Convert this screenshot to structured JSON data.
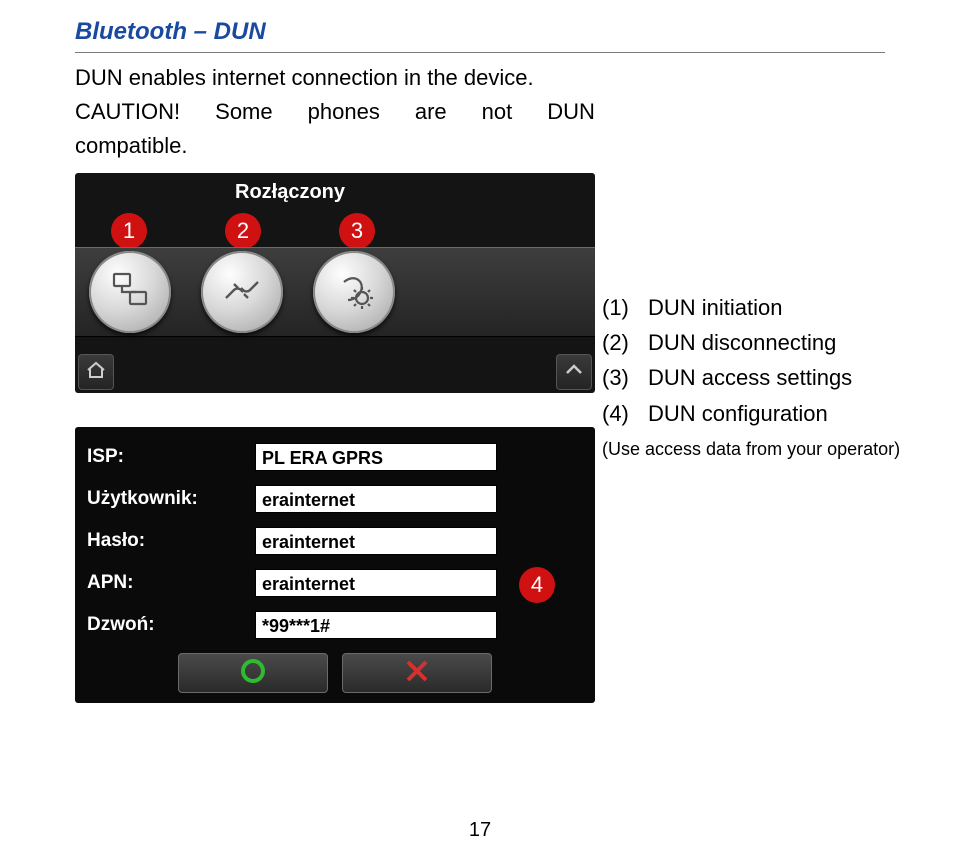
{
  "heading": "Bluetooth – DUN",
  "intro": "DUN enables internet connection in the device.",
  "caution_label": "CAUTION!",
  "caution_words": [
    "Some",
    "phones",
    "are",
    "not",
    "DUN"
  ],
  "caution_tail": "compatible.",
  "screenshot1": {
    "status": "Rozłączony",
    "badges": [
      "1",
      "2",
      "3"
    ],
    "buttons": [
      {
        "name": "dun-initiation-button",
        "icon": "network-icon"
      },
      {
        "name": "dun-disconnect-button",
        "icon": "unplug-icon"
      },
      {
        "name": "dun-settings-button",
        "icon": "browser-gear-icon"
      }
    ],
    "corner_left_icon": "home-icon",
    "corner_right_icon": "chevron-up-icon"
  },
  "legend": {
    "items": [
      {
        "num": "(1)",
        "text": "DUN initiation"
      },
      {
        "num": "(2)",
        "text": "DUN disconnecting"
      },
      {
        "num": "(3)",
        "text": "DUN access settings"
      },
      {
        "num": "(4)",
        "text": "DUN configuration"
      }
    ],
    "note": "(Use access data from your operator)"
  },
  "screenshot2": {
    "fields": [
      {
        "label": "ISP:",
        "value": "PL ERA GPRS"
      },
      {
        "label": "Użytkownik:",
        "value": "erainternet"
      },
      {
        "label": "Hasło:",
        "value": "erainternet"
      },
      {
        "label": "APN:",
        "value": "erainternet"
      },
      {
        "label": "Dzwoń:",
        "value": "*99***1#"
      }
    ],
    "badge": "4",
    "ok_icon": "circle-icon",
    "cancel_icon": "x-icon"
  },
  "page_number": "17"
}
